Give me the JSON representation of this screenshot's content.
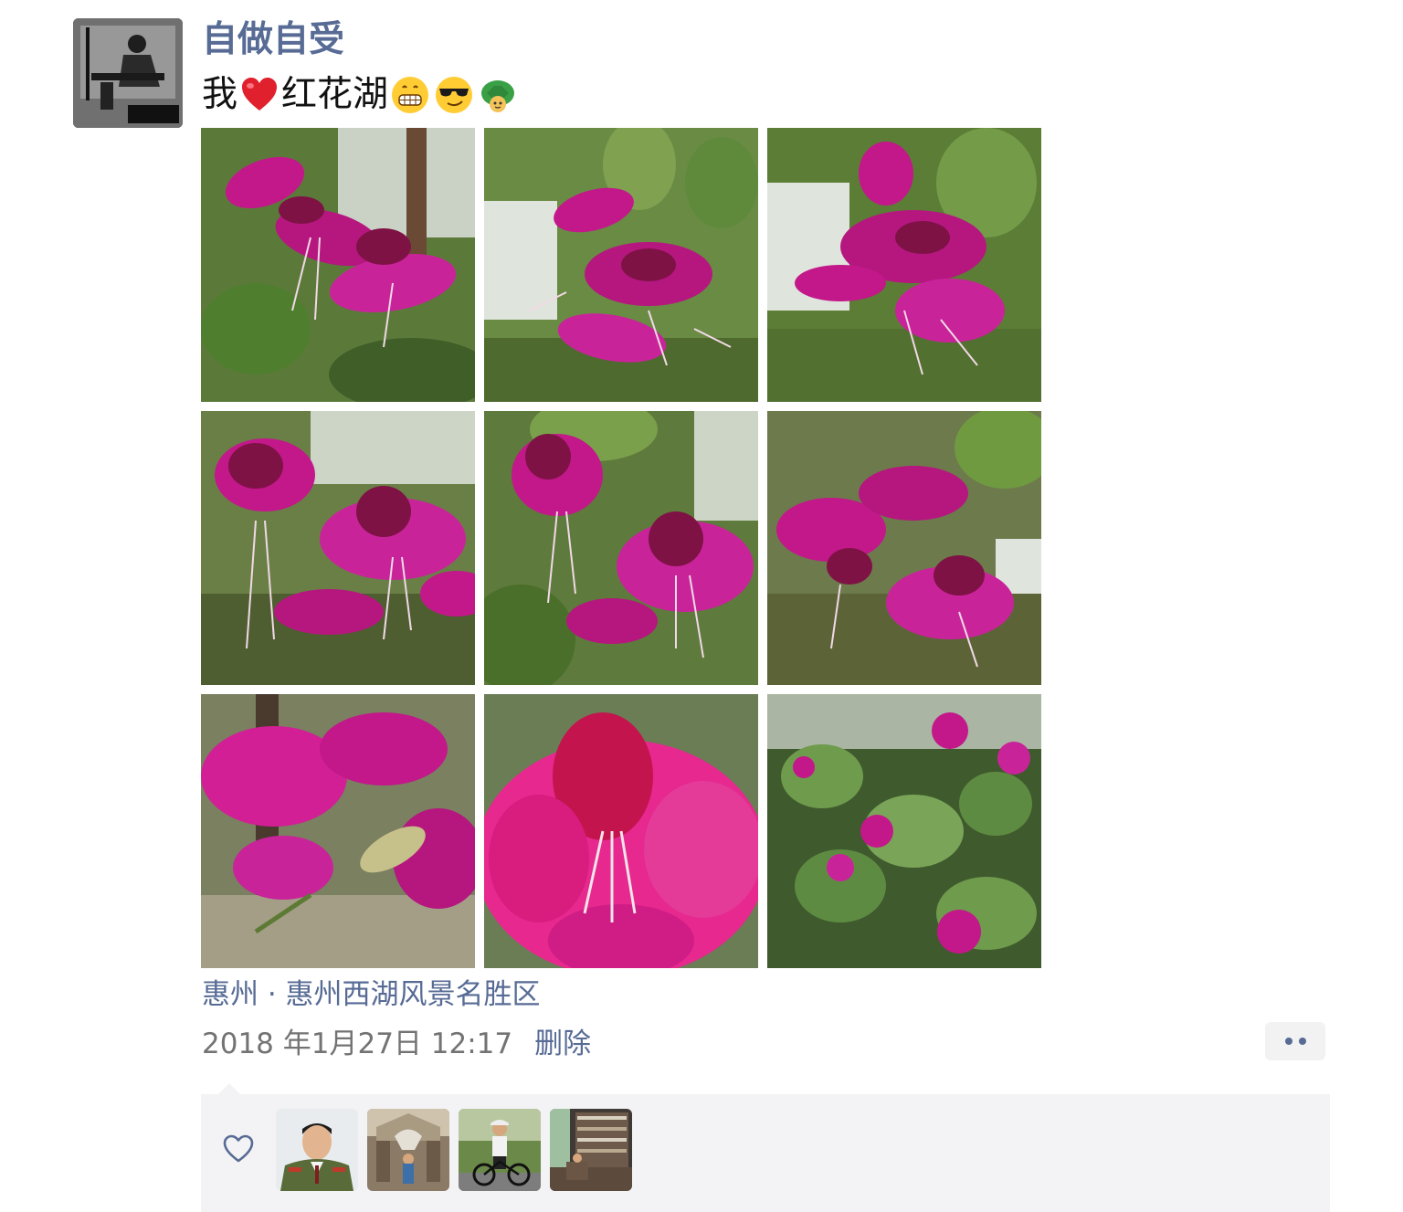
{
  "post": {
    "username": "自做自受",
    "text_before": "我",
    "text_after": "红花湖",
    "emojis": [
      "heart-emoji",
      "grinning-face-emoji",
      "sunglasses-face-emoji",
      "turtle-emoji"
    ],
    "photos": [
      {
        "name": "orchid-tree-flowers-photo-1"
      },
      {
        "name": "orchid-tree-flowers-photo-2"
      },
      {
        "name": "orchid-tree-flowers-photo-3"
      },
      {
        "name": "orchid-tree-flowers-photo-4"
      },
      {
        "name": "orchid-tree-flowers-photo-5"
      },
      {
        "name": "orchid-tree-flowers-photo-6"
      },
      {
        "name": "orchid-tree-flowers-photo-7"
      },
      {
        "name": "orchid-tree-flowers-photo-8"
      },
      {
        "name": "orchid-tree-flowers-photo-9"
      }
    ],
    "location": "惠州 · 惠州西湖风景名胜区",
    "timestamp": "2018 年1月27日 12:17",
    "delete_label": "删除"
  },
  "likes": {
    "icon": "heart-outline-icon",
    "avatars": [
      "liker-avatar-1",
      "liker-avatar-2",
      "liker-avatar-3",
      "liker-avatar-4"
    ]
  },
  "colors": {
    "link_blue": "#576b95",
    "timestamp_gray": "#737373",
    "panel_bg": "#f3f3f5",
    "flower_magenta": "#c2188a"
  }
}
